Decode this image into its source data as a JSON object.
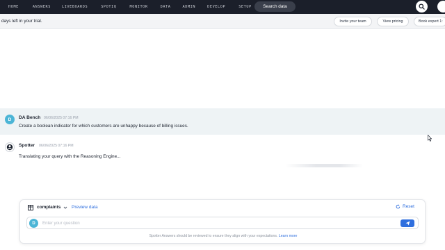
{
  "nav": {
    "items": [
      "HOME",
      "ANSWERS",
      "LIVEBOARDS",
      "SPOTIQ",
      "MONITOR",
      "DATA",
      "ADMIN",
      "DEVELOP",
      "SETUP"
    ],
    "search_label": "Search data"
  },
  "banner": {
    "trial_text": "days left in your trial.",
    "invite_label": "Invite your team",
    "pricing_label": "View pricing",
    "expert_label": "Book expert 1:"
  },
  "conversation": {
    "user": {
      "avatar_letter": "D",
      "name": "DA Bench",
      "time": "06/06/2025 07:16 PM",
      "text": "Create a boolean indicator for which customers are unhappy because of billing issues."
    },
    "spotter": {
      "name": "Spotter",
      "time": "06/06/2025 07:16 PM",
      "text": "Translating your query with the Reasoning Engine..."
    }
  },
  "input_panel": {
    "datasource": "complaints",
    "preview_label": "Preview data",
    "reset_label": "Reset",
    "avatar_letter": "D",
    "placeholder": "Enter your question",
    "value": "",
    "disclaimer": "Spotter Answers should be reviewed to ensure they align with your expectations.",
    "learn_more": "Learn more"
  },
  "icons": {
    "search": "search-icon",
    "nav_more": "partial-circle-icon",
    "spotter": "spotter-logo-icon",
    "table": "table-icon",
    "chevron": "chevron-down-icon",
    "reset": "reset-icon",
    "send": "send-icon",
    "cursor": "mouse-pointer-icon"
  },
  "colors": {
    "nav_bg": "#1b1f2a",
    "accent": "#2f6fde",
    "avatar": "#4cb5d6",
    "user_msg_bg": "#eef3f5"
  }
}
